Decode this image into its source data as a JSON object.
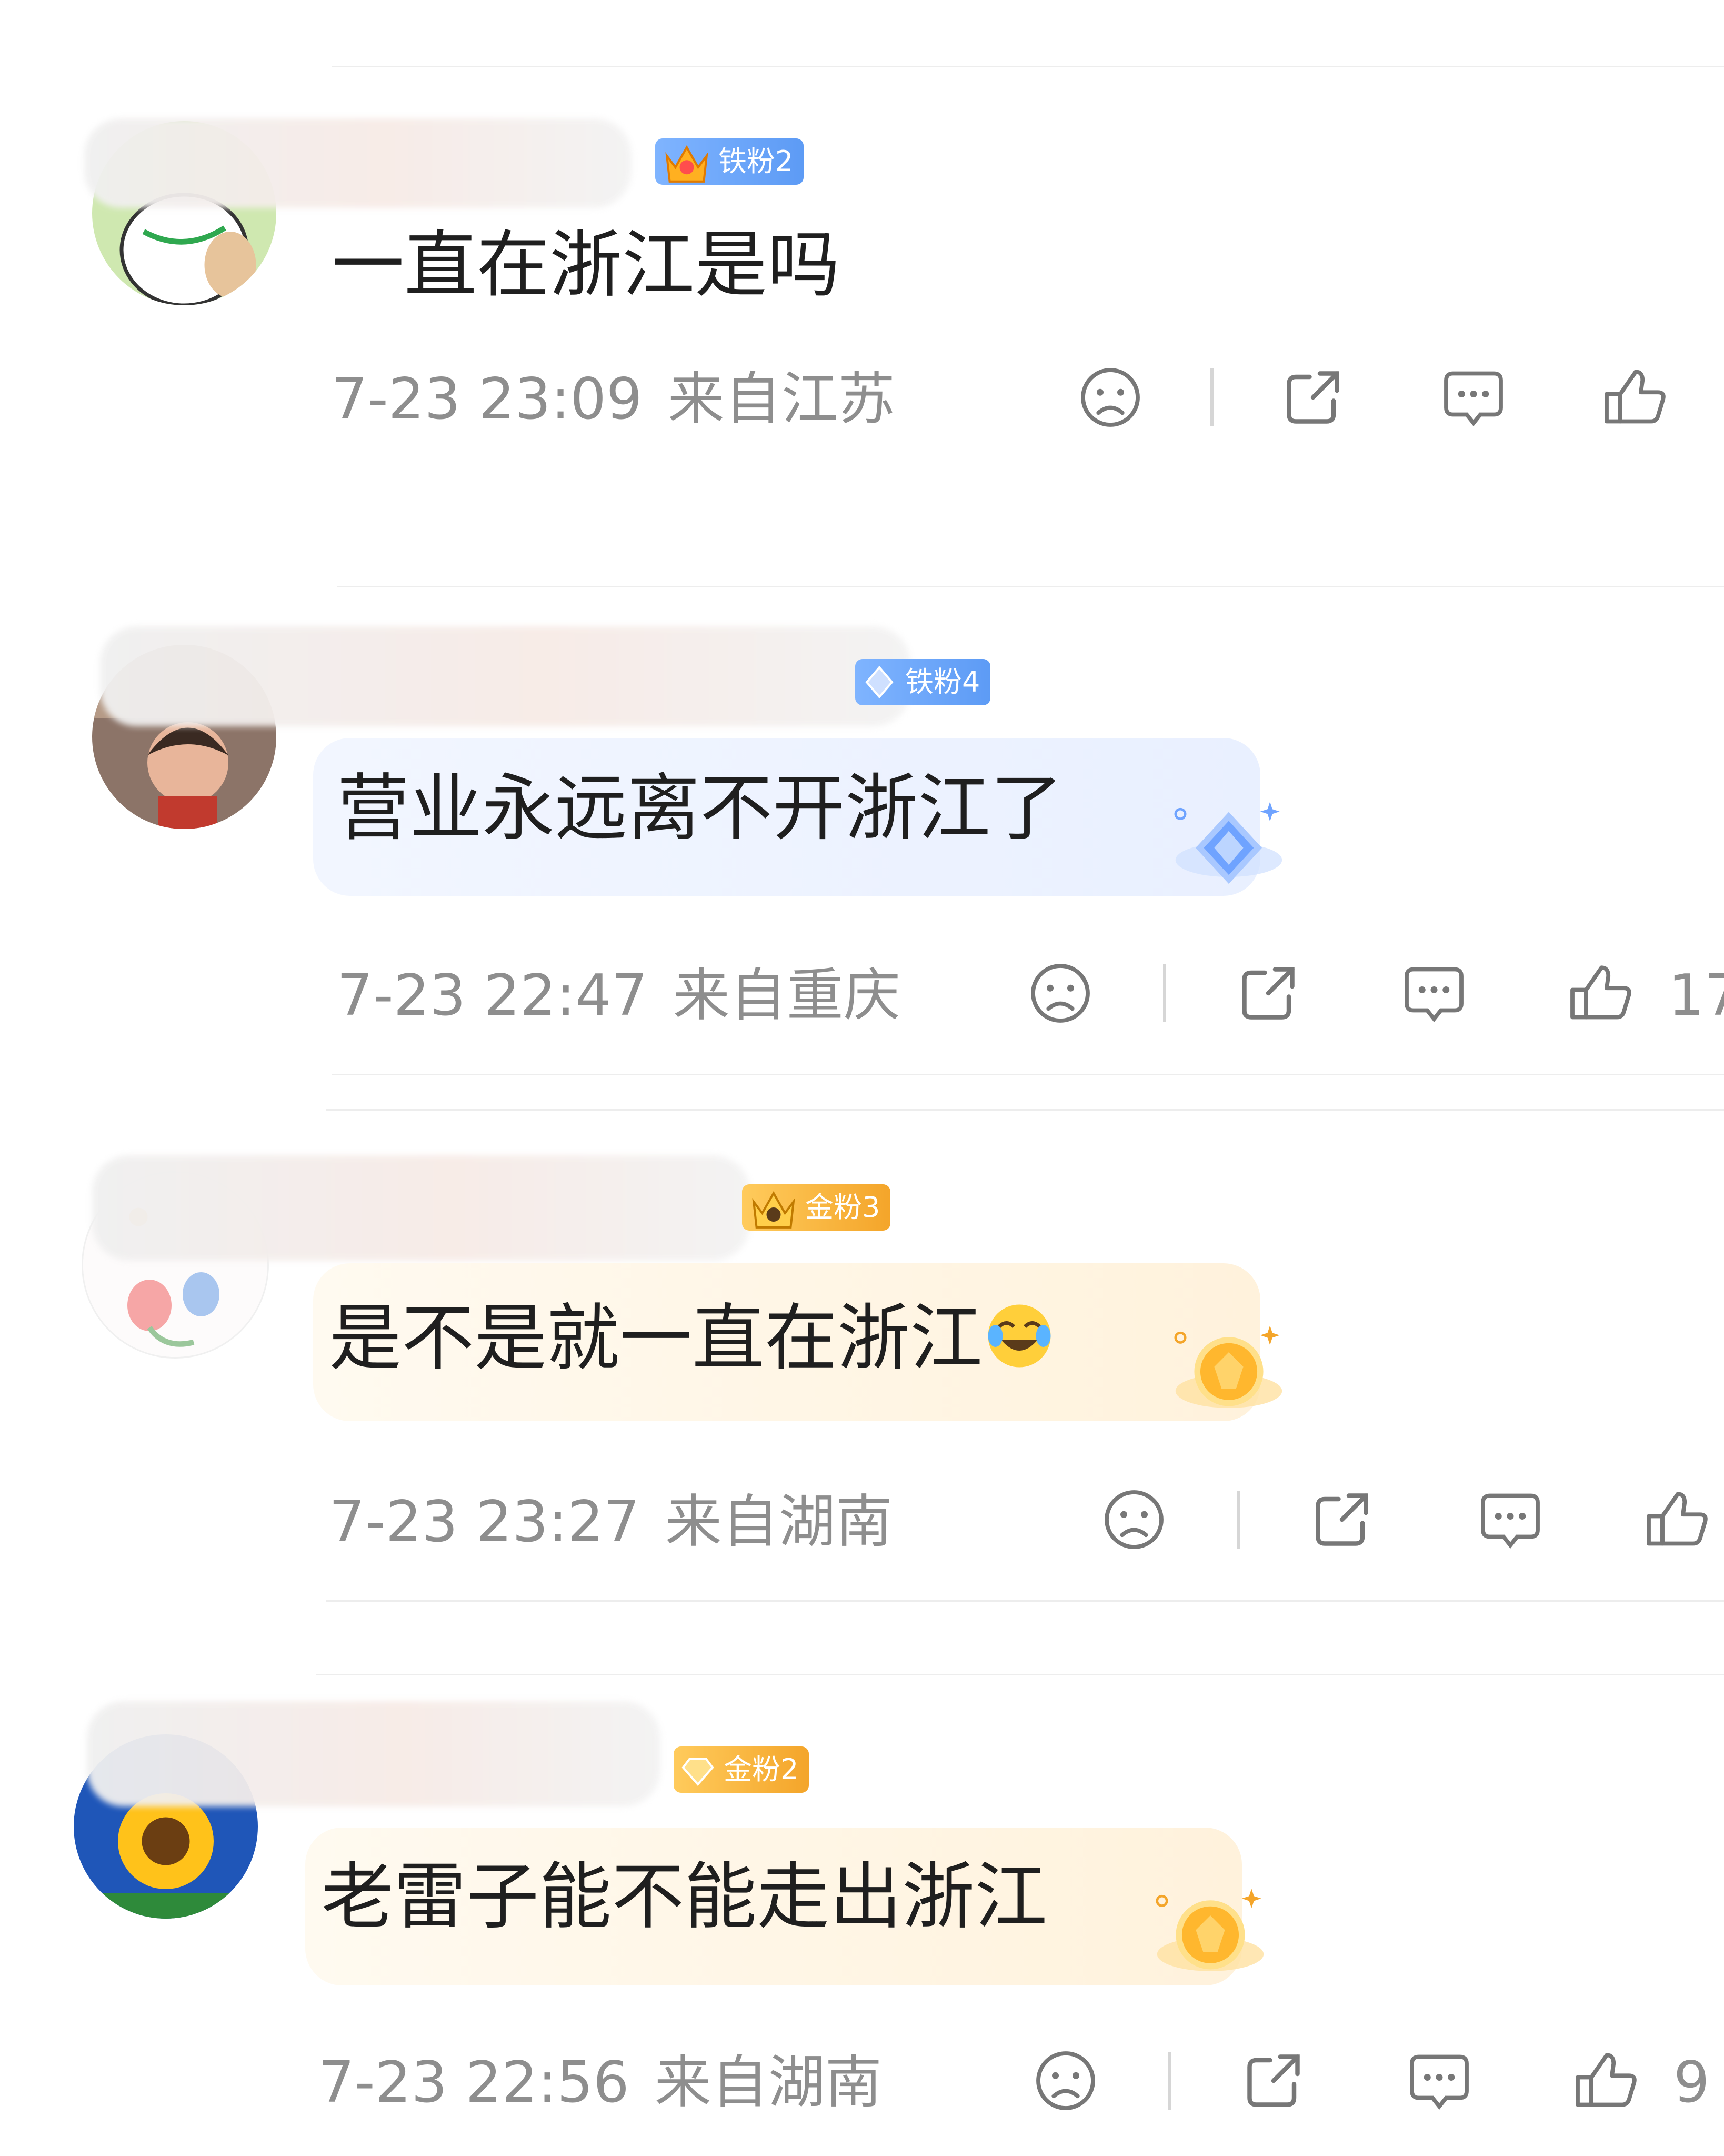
{
  "comments": [
    {
      "badge": "铁粉2",
      "badge_type": "iron",
      "text": "一直在浙江是吗",
      "time": "7-23 23:09",
      "location": "来自江苏",
      "likes": ""
    },
    {
      "badge": "铁粉4",
      "badge_type": "iron",
      "text": "营业永远离不开浙江了",
      "time": "7-23 22:47",
      "location": "来自重庆",
      "likes": "17"
    },
    {
      "badge": "金粉3",
      "badge_type": "gold",
      "text": "是不是就一直在浙江",
      "emoji": "laugh-cry-emoji",
      "time": "7-23 23:27",
      "location": "来自湖南",
      "likes": ""
    },
    {
      "badge": "金粉2",
      "badge_type": "gold",
      "text": "老雷子能不能走出浙江",
      "time": "7-23 22:56",
      "location": "来自湖南",
      "likes": "9"
    }
  ],
  "colors": {
    "iron_badge": "#5d9bf5",
    "gold_badge": "#f4a52a",
    "meta_text": "#8e8e8e",
    "body_text": "#1f1f1f"
  },
  "icons": {
    "dislike": "sad-face-icon",
    "share": "share-icon",
    "comment": "comment-bubble-icon",
    "like": "thumbs-up-icon"
  }
}
